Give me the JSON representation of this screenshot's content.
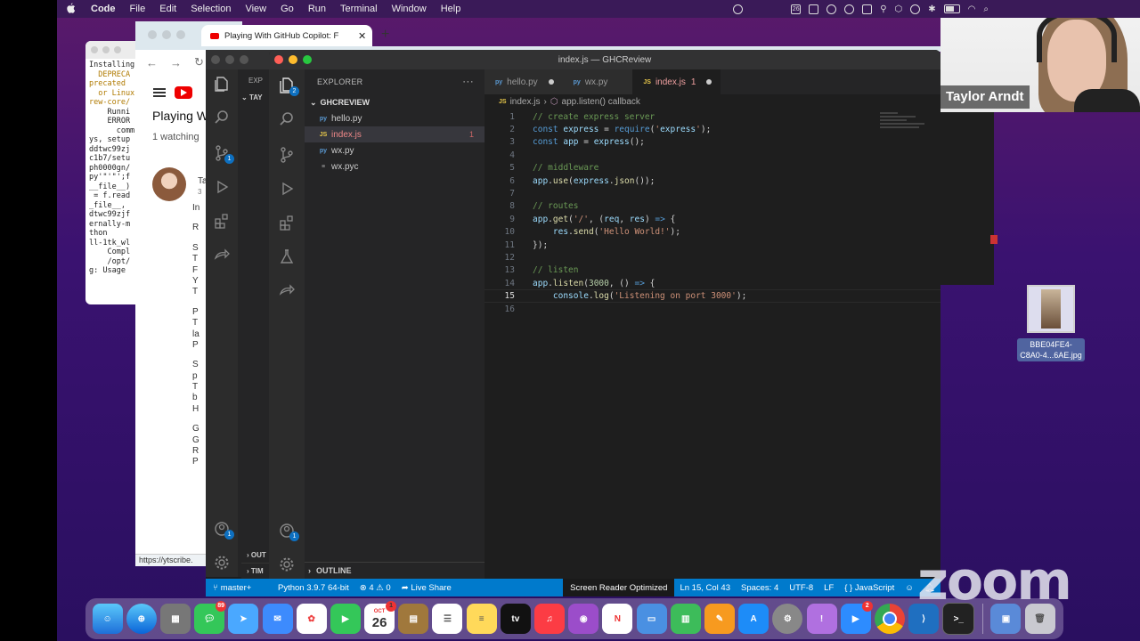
{
  "menubar": {
    "app": "Code",
    "items": [
      "File",
      "Edit",
      "Selection",
      "View",
      "Go",
      "Run",
      "Terminal",
      "Window",
      "Help"
    ],
    "calendar_day": "26"
  },
  "browser": {
    "tab_title": "Playing With GitHub Copilot: F",
    "video_title": "Playing W",
    "watching": "1 watching",
    "channel_letters": [
      "Ta",
      "3",
      ""
    ],
    "side_letters": [
      "In",
      "R",
      "S",
      "T",
      "F",
      "Y",
      "T",
      "P",
      "T",
      "la",
      "P",
      "S",
      "p",
      "T",
      "b",
      "H",
      "G",
      "G",
      "R",
      "P"
    ],
    "status_url": "https://ytscribe."
  },
  "terminal": {
    "lines": [
      "Installing",
      "  DEPRECA",
      "precated ",
      "  or Linux",
      "rew-core/",
      "    Runni",
      "    ERROR",
      "      comm",
      "ys, setup",
      "ddtwc99zj",
      "c1b7/setu",
      "ph0000gn/",
      "py'\"'\"';f",
      "__file__)",
      " = f.read",
      "_file__, ",
      "dtwc99zjf",
      "ernally-m",
      "thon",
      "",
      "ll-1tk_wl",
      "    Compl",
      "    /opt/",
      "g: Usage "
    ]
  },
  "back_window": {
    "explorer": "EXP",
    "folder": "TAY",
    "outline": "OUT",
    "timeline": "TIM",
    "branch": "master+"
  },
  "vscode": {
    "title": "index.js — GHCReview",
    "explorer_label": "EXPLORER",
    "folder": "GHCREVIEW",
    "files": [
      {
        "name": "hello.py",
        "icon": "py",
        "active": false,
        "count": ""
      },
      {
        "name": "index.js",
        "icon": "JS",
        "active": true,
        "count": "1"
      },
      {
        "name": "wx.py",
        "icon": "py",
        "active": false,
        "count": ""
      },
      {
        "name": "wx.pyc",
        "icon": "≡",
        "active": false,
        "count": ""
      }
    ],
    "outline_label": "OUTLINE",
    "tabs": [
      {
        "label": "hello.py",
        "icon": "py",
        "modified": true
      },
      {
        "label": "wx.py",
        "icon": "py",
        "modified": false
      },
      {
        "label": "index.js",
        "count": "1",
        "icon": "JS",
        "modified": true
      }
    ],
    "breadcrumb": [
      "index.js",
      "app.listen() callback"
    ],
    "code": [
      "// create express server",
      "const express = require('express');",
      "const app = express();",
      "",
      "// middleware",
      "app.use(express.json());",
      "",
      "// routes",
      "app.get('/', (req, res) => {",
      "    res.send('Hello World!');",
      "});",
      "",
      "// listen",
      "app.listen(3000, () => {",
      "    console.log('Listening on port 3000');",
      ""
    ],
    "current_line": 15,
    "statusbar": {
      "python": "Python 3.9.7 64-bit",
      "problems": "⊗ 4 ⚠ 0",
      "liveshare": "Live Share",
      "screenreader": "Screen Reader Optimized",
      "position": "Ln 15, Col 43",
      "spaces": "Spaces: 4",
      "encoding": "UTF-8",
      "eol": "LF",
      "language": "JavaScript"
    },
    "activity_badges": {
      "source_control": "2",
      "accounts": "1"
    }
  },
  "zoom": {
    "participant_name": "Taylor Arndt",
    "logo": "zoom"
  },
  "desktop_file": {
    "label": "BBE04FE4-\nC8A0-4...6AE.jpg"
  },
  "dock": {
    "calendar_month": "OCT",
    "calendar_day": "26",
    "tv_label": "tv",
    "badges": {
      "messages": "89",
      "calendar": "1",
      "zoom": "2"
    }
  }
}
